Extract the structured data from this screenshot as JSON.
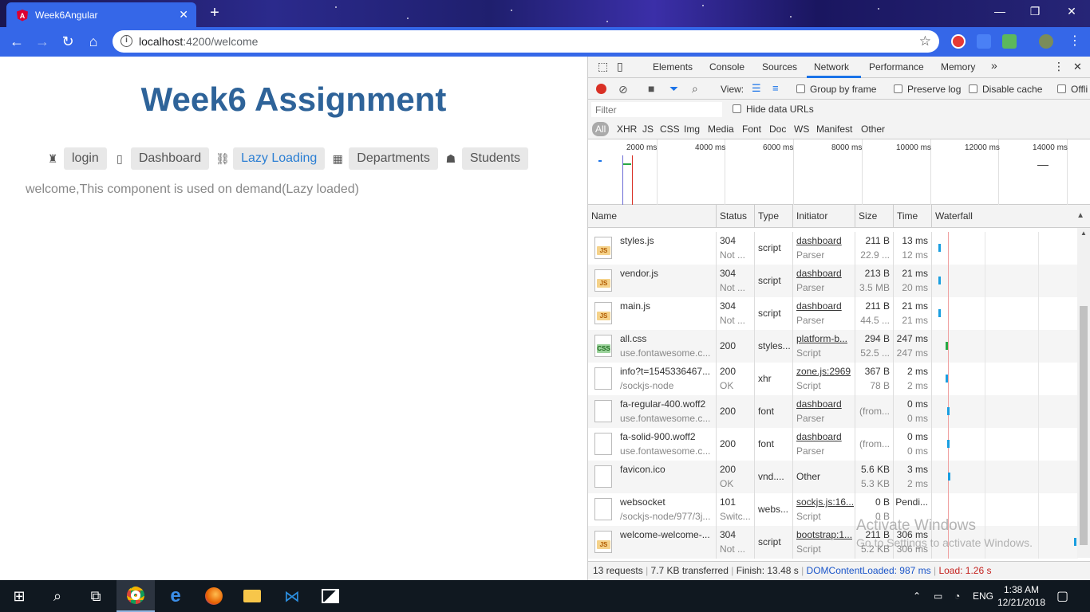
{
  "browser": {
    "tab_title": "Week6Angular",
    "url_host": "localhost",
    "url_rest": ":4200/welcome",
    "tab_close": "✕",
    "new_tab": "+"
  },
  "page": {
    "heading": "Week6 Assignment",
    "nav": [
      {
        "label": "login",
        "icon": "user-secret-icon",
        "active": false
      },
      {
        "label": "Dashboard",
        "icon": "clipboard-icon",
        "active": false
      },
      {
        "label": "Lazy Loading",
        "icon": "link-icon",
        "active": true
      },
      {
        "label": "Departments",
        "icon": "building-icon",
        "active": false
      },
      {
        "label": "Students",
        "icon": "graduate-icon",
        "active": false
      }
    ],
    "welcome_text": "welcome,This component is used on demand(Lazy loaded)"
  },
  "devtools": {
    "tabs": [
      "Elements",
      "Console",
      "Sources",
      "Network",
      "Performance",
      "Memory"
    ],
    "active_tab": "Network",
    "more_tabs": "»",
    "toolbar": {
      "view_label": "View:",
      "group_by_frame": "Group by frame",
      "preserve_log": "Preserve log",
      "disable_cache": "Disable cache",
      "offline": "Offli"
    },
    "filter_placeholder": "Filter",
    "hide_data_urls": "Hide data URLs",
    "types": [
      "All",
      "XHR",
      "JS",
      "CSS",
      "Img",
      "Media",
      "Font",
      "Doc",
      "WS",
      "Manifest",
      "Other"
    ],
    "overview_ticks": [
      "2000 ms",
      "4000 ms",
      "6000 ms",
      "8000 ms",
      "10000 ms",
      "12000 ms",
      "14000 ms"
    ],
    "columns": [
      "Name",
      "Status",
      "Type",
      "Initiator",
      "Size",
      "Time",
      "Waterfall"
    ],
    "rows": [
      {
        "name": "styles.js",
        "sub": "",
        "status": "304",
        "status2": "Not ...",
        "type": "script",
        "initiator": "dashboard",
        "initiator2": "Parser",
        "size": "211 B",
        "size2": "22.9 ...",
        "time": "13 ms",
        "time2": "12 ms",
        "icon": "JS"
      },
      {
        "name": "vendor.js",
        "sub": "",
        "status": "304",
        "status2": "Not ...",
        "type": "script",
        "initiator": "dashboard",
        "initiator2": "Parser",
        "size": "213 B",
        "size2": "3.5 MB",
        "time": "21 ms",
        "time2": "20 ms",
        "icon": "JS"
      },
      {
        "name": "main.js",
        "sub": "",
        "status": "304",
        "status2": "Not ...",
        "type": "script",
        "initiator": "dashboard",
        "initiator2": "Parser",
        "size": "211 B",
        "size2": "44.5 ...",
        "time": "21 ms",
        "time2": "21 ms",
        "icon": "JS"
      },
      {
        "name": "all.css",
        "sub": "use.fontawesome.c...",
        "status": "200",
        "status2": "",
        "type": "styles...",
        "initiator": "platform-b...",
        "initiator2": "Script",
        "size": "294 B",
        "size2": "52.5 ...",
        "time": "247 ms",
        "time2": "247 ms",
        "icon": "CSS"
      },
      {
        "name": "info?t=1545336467...",
        "sub": "/sockjs-node",
        "status": "200",
        "status2": "OK",
        "type": "xhr",
        "initiator": "zone.js:2969",
        "initiator2": "Script",
        "size": "367 B",
        "size2": "78 B",
        "time": "2 ms",
        "time2": "2 ms",
        "icon": ""
      },
      {
        "name": "fa-regular-400.woff2",
        "sub": "use.fontawesome.c...",
        "status": "200",
        "status2": "",
        "type": "font",
        "initiator": "dashboard",
        "initiator2": "Parser",
        "size": "(from...",
        "size2": "",
        "time": "0 ms",
        "time2": "0 ms",
        "icon": ""
      },
      {
        "name": "fa-solid-900.woff2",
        "sub": "use.fontawesome.c...",
        "status": "200",
        "status2": "",
        "type": "font",
        "initiator": "dashboard",
        "initiator2": "Parser",
        "size": "(from...",
        "size2": "",
        "time": "0 ms",
        "time2": "0 ms",
        "icon": ""
      },
      {
        "name": "favicon.ico",
        "sub": "",
        "status": "200",
        "status2": "OK",
        "type": "vnd....",
        "initiator": "Other",
        "initiator2": "",
        "size": "5.6 KB",
        "size2": "5.3 KB",
        "time": "3 ms",
        "time2": "2 ms",
        "icon": ""
      },
      {
        "name": "websocket",
        "sub": "/sockjs-node/977/3j...",
        "status": "101",
        "status2": "Switc...",
        "type": "webs...",
        "initiator": "sockjs.js:16...",
        "initiator2": "Script",
        "size": "0 B",
        "size2": "0 B",
        "time": "Pendi...",
        "time2": "",
        "icon": ""
      },
      {
        "name": "welcome-welcome-...",
        "sub": "",
        "status": "304",
        "status2": "Not ...",
        "type": "script",
        "initiator": "bootstrap:1...",
        "initiator2": "Script",
        "size": "211 B",
        "size2": "5.2 KB",
        "time": "306 ms",
        "time2": "306 ms",
        "icon": "JS"
      }
    ],
    "status_bar": {
      "requests": "13 requests",
      "transferred": "7.7 KB transferred",
      "finish": "Finish: 13.48 s",
      "dcl": "DOMContentLoaded: 987 ms",
      "load": "Load: 1.26 s"
    },
    "watermark_line1": "Activate Windows",
    "watermark_line2": "Go to Settings to activate Windows."
  },
  "taskbar": {
    "language": "ENG",
    "time": "1:38 AM",
    "date": "12/21/2018"
  },
  "colors": {
    "accent": "#3567e8",
    "heading": "#2e6399",
    "dcl": "#1a55c9",
    "load": "#c5221f"
  }
}
